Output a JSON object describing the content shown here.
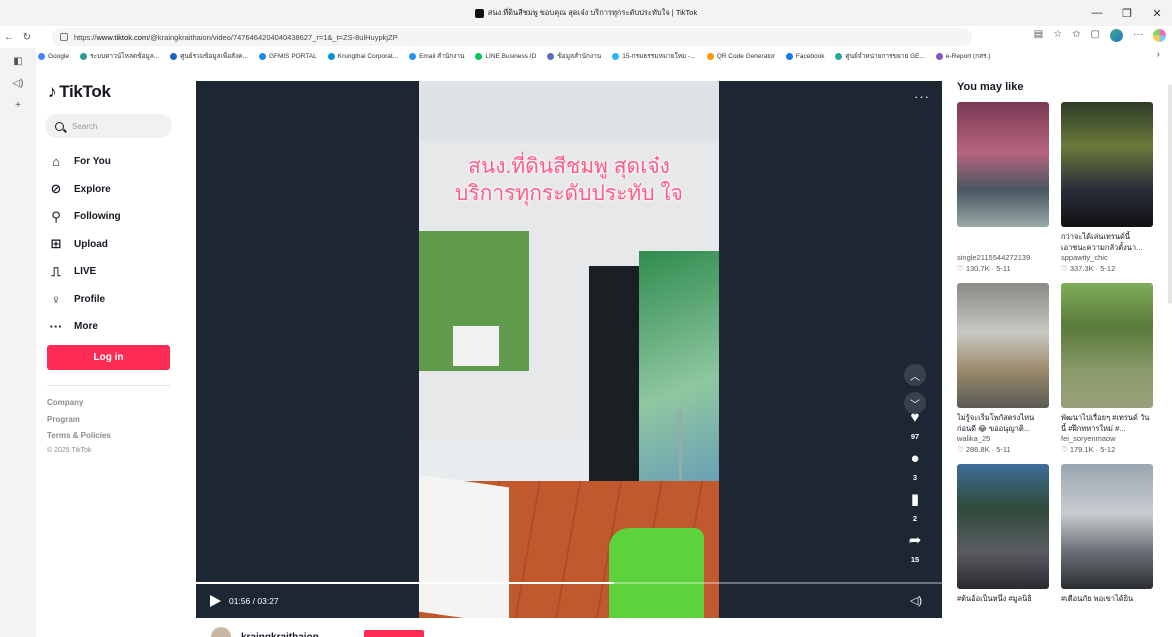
{
  "browser": {
    "tab_title": "สนง.ที่ดินสีชมพู ขอบคุณ สุดเจ๋ง บริการทุกระดับประทับใจ | TikTok",
    "url_prefix": "https://",
    "url_host": "www.tiktok.com",
    "url_path": "/@kraingkraithaion/video/7476464204040438627_r=1&_t=ZS-8ulHuypkjZP",
    "bookmarks": [
      {
        "label": "Google",
        "color": "#4285f4"
      },
      {
        "label": "ระบบดาวน์โหลดข้อมูล...",
        "color": "#2a9d8f"
      },
      {
        "label": "ศูนย์รวมข้อมูลเพื่อสังค...",
        "color": "#1565c0"
      },
      {
        "label": "GFMIS PORTAL",
        "color": "#1e88e5"
      },
      {
        "label": "Krungthai Corporat...",
        "color": "#0096d6"
      },
      {
        "label": "Email สำนักงาน",
        "color": "#2196f3"
      },
      {
        "label": "LINE Business ID",
        "color": "#06c755"
      },
      {
        "label": "ข้อมูลสำนักงาน",
        "color": "#5c6bc0"
      },
      {
        "label": "15-กรมธรรมหมายใหม -...",
        "color": "#29b6f6"
      },
      {
        "label": "QR Code Generator",
        "color": "#ff9800"
      },
      {
        "label": "Facebook",
        "color": "#1877f2"
      },
      {
        "label": "ศูนย์จำหน่ายการขยาย GE...",
        "color": "#26a69a"
      },
      {
        "label": "e-Report (กสร.)",
        "color": "#7e57c2"
      }
    ]
  },
  "sidebar": {
    "brand": "TikTok",
    "search_placeholder": "Search",
    "nav": [
      {
        "label": "For You",
        "icon": "home-icon"
      },
      {
        "label": "Explore",
        "icon": "compass-icon"
      },
      {
        "label": "Following",
        "icon": "user-plus-icon"
      },
      {
        "label": "Upload",
        "icon": "upload-icon"
      },
      {
        "label": "LIVE",
        "icon": "live-icon"
      },
      {
        "label": "Profile",
        "icon": "user-icon"
      },
      {
        "label": "More",
        "icon": "more-icon"
      }
    ],
    "login_label": "Log in",
    "footer": [
      "Company",
      "Program",
      "Terms & Policies"
    ],
    "copyright": "© 2025 TikTok"
  },
  "video": {
    "caption_line1": "สนง.ที่ดินสีชมพู สุดเจ๋ง",
    "caption_line2": "บริการทุกระดับประทับ ใจ",
    "likes": "97",
    "comments": "3",
    "saves": "2",
    "shares": "15",
    "current_time": "01:56",
    "duration": "03:27",
    "progress": 0.56,
    "author": "kraingkraithaion"
  },
  "suggestions": {
    "heading": "You may like",
    "items": [
      {
        "title": "",
        "user": "single2115544272139",
        "likes": "130.7K",
        "date": "5-11"
      },
      {
        "title": "กว่าจะได้เล่นเทรนด์นี้ เอาชนะความกลัวตั้งนา...",
        "user": "sppawity_chic",
        "likes": "337.3K",
        "date": "5-12"
      },
      {
        "title": "ไม่รู้จะเริ่มโพกัสตรงไหน ก่อนดี 😂 ขออนุญาติ...",
        "user": "walika_25",
        "likes": "286.8K",
        "date": "5-11"
      },
      {
        "title": "พัฒนาไปเรื่อยๆ #เทรนด์ วันนี้ #ฝึกทหารใหม่ #...",
        "user": "fei_soryenmaow",
        "likes": "179.1K",
        "date": "5-12"
      },
      {
        "title": "#ต้นอ้อเป็นหนึ่ง #มูลนิธิ",
        "user": "",
        "likes": "",
        "date": ""
      },
      {
        "title": "#เตือนภัย พอเขาได้ยิน",
        "user": "",
        "likes": "",
        "date": ""
      }
    ]
  }
}
